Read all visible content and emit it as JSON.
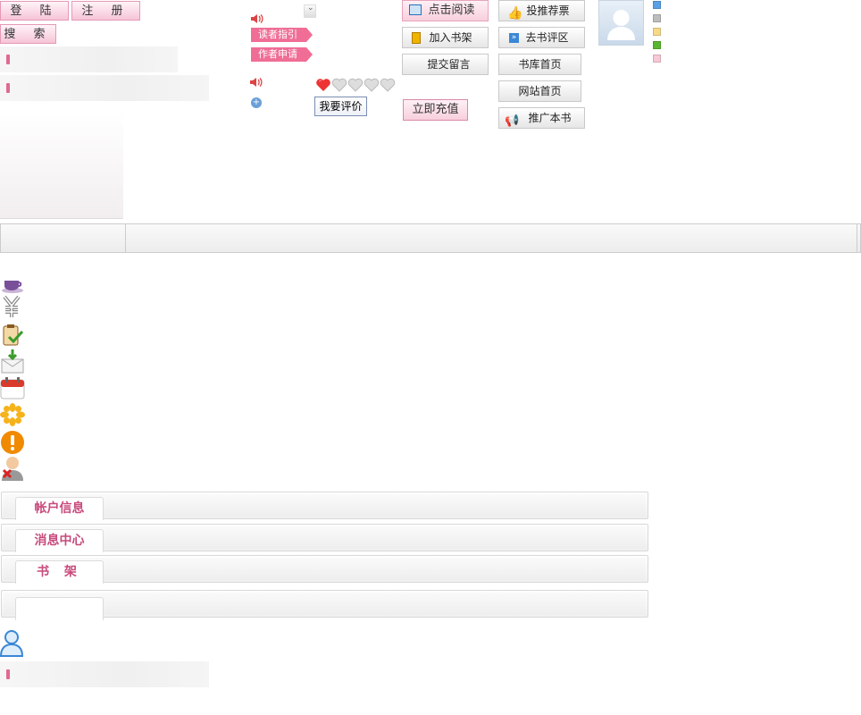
{
  "top_buttons": {
    "login": "登 陆",
    "register": "注 册",
    "search": "搜 索"
  },
  "reader_links": {
    "reader_guide": "读者指引",
    "author_apply": "作者申请"
  },
  "rating": {
    "stars_filled": 1,
    "stars_total": 5,
    "review_button": "我要评价"
  },
  "book_actions": {
    "read": "点击阅读",
    "add_shelf": "加入书架",
    "leave_message": "提交留言",
    "recharge": "立即充值",
    "recommend_vote": "投推荐票",
    "go_review": "去书评区",
    "library_home": "书库首页",
    "site_home": "网站首页",
    "promote": "推广本书"
  },
  "color_swatches": [
    "#5aa0e6",
    "#bdbdbd",
    "#f7d98a",
    "#5ab62f",
    "#f7c9d4"
  ],
  "panels": {
    "account": "帐户信息",
    "messages": "消息中心",
    "bookshelf": "书 架",
    "empty": ""
  },
  "colors": {
    "accent": "#e06a8f",
    "tab_text": "#c84a7c"
  }
}
